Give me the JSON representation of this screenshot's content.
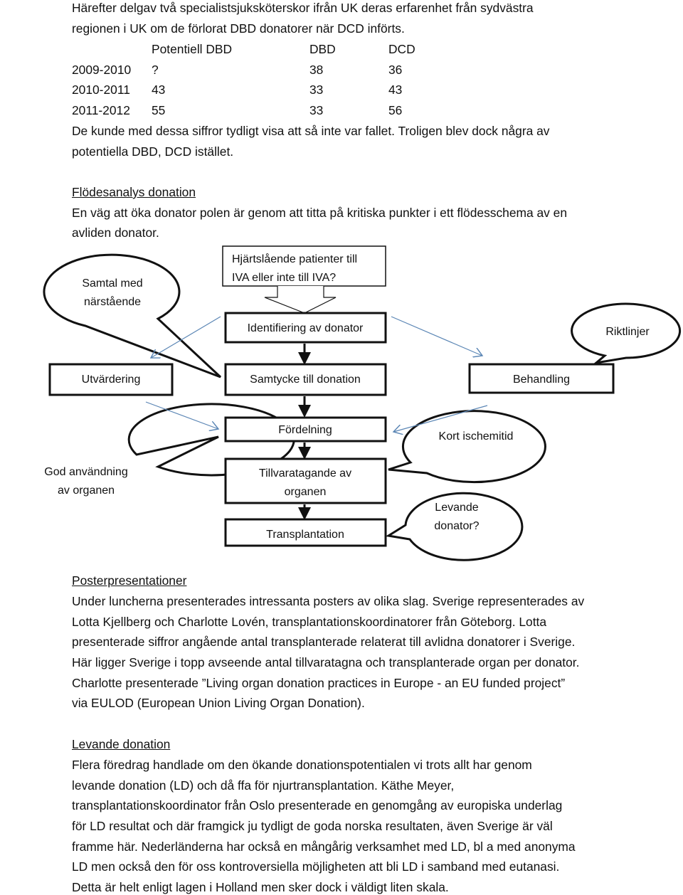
{
  "intro": [
    "Härefter delgav två specialistsjuksköterskor ifrån UK deras erfarenhet från sydvästra",
    "regionen i UK om de förlorat DBD donatorer när DCD införts."
  ],
  "table": {
    "headers": [
      "",
      "Potentiell DBD",
      "DBD",
      "DCD"
    ],
    "rows": [
      [
        "2009-2010",
        "?",
        "38",
        "36"
      ],
      [
        "2010-2011",
        "43",
        "33",
        "43"
      ],
      [
        "2011-2012",
        "55",
        "33",
        "56"
      ]
    ]
  },
  "after_table": [
    "De kunde med dessa siffror tydligt visa att så inte var fallet. Troligen blev dock några av",
    "potentiella DBD, DCD istället."
  ],
  "flow_section": {
    "heading": "Flödesanalys donation",
    "lines": [
      "En väg att öka donator polen är genom att titta på kritiska punkter i ett flödesschema av en",
      "avliden donator."
    ]
  },
  "diagram": {
    "top_box": [
      "Hjärtslående patienter till",
      "IVA eller inte till IVA?"
    ],
    "identifiering": "Identifiering av donator",
    "samtycke": "Samtycke till donation",
    "utvardering": "Utvärdering",
    "behandling": "Behandling",
    "fordelning": "Fördelning",
    "tillvaratagande": [
      "Tillvaratagande av",
      "organen"
    ],
    "transplantation": "Transplantation",
    "bubble_samtal": [
      "Samtal med",
      "närstående"
    ],
    "bubble_riktlinjer": "Riktlinjer",
    "bubble_kort": "Kort ischemitid",
    "bubble_god": [
      "God användning",
      "av organen"
    ],
    "bubble_levande": [
      "Levande",
      "donator?"
    ],
    "arrow_color": "#5b86b5"
  },
  "poster_section": {
    "heading": "Posterpresentationer",
    "lines": [
      "Under luncherna presenterades intressanta posters av olika slag. Sverige representerades av",
      "Lotta Kjellberg och Charlotte Lovén, transplantationskoordinatorer från Göteborg. Lotta",
      "presenterade siffror angående antal transplanterade relaterat till avlidna donatorer i Sverige.",
      "Här ligger Sverige i topp avseende antal tillvaratagna och transplanterade organ per donator.",
      "Charlotte presenterade ”Living organ donation practices in Europe - an EU funded project”",
      "via EULOD (European Union Living Organ Donation)."
    ]
  },
  "living_section": {
    "heading": "Levande donation",
    "lines": [
      "Flera föredrag handlade om den ökande donationspotentialen vi trots allt har genom",
      "levande donation (LD) och då ffa för njurtransplantation. Käthe Meyer,",
      "transplantationskoordinator från Oslo presenterade en genomgång av europiska underlag",
      "för LD resultat och där framgick ju tydligt de goda norska resultaten, även Sverige är väl",
      "framme här. Nederländerna har också en mångårig verksamhet med LD, bl a med anonyma",
      "LD men också den för oss kontroversiella möjligheten att bli LD i samband med eutanasi.",
      "Detta är helt enligt lagen i Holland men sker dock i väldigt liten skala."
    ]
  }
}
